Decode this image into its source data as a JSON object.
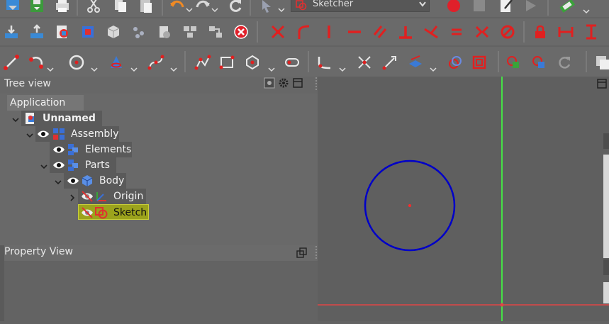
{
  "toolbar": {
    "workbench": {
      "label": "Sketcher",
      "icon": "sketcher-icon"
    },
    "row1_icons": [
      "import-icon",
      "save-icon",
      "print-icon",
      "cut-icon",
      "copy-icon",
      "paste-icon",
      "undo-icon",
      "redo-icon",
      "refresh-icon",
      "select-icon",
      "record-macro-icon",
      "stop-macro-icon",
      "macro-editor-icon",
      "run-macro-icon",
      "measure-icon"
    ],
    "row2_icons": [
      "assembly-import-icon",
      "assembly-export-icon",
      "insert-link-icon",
      "assembly-solve-icon",
      "part-icon",
      "assembly-parts-icon",
      "assembly-config-icon",
      "assembly-constraint-icon",
      "assembly-list-icon",
      "delete-constraint-icon",
      "fix-point-icon",
      "tangent-constraint-icon",
      "vertical-constraint-icon",
      "horizontal-constraint-icon",
      "parallel-constraint-icon",
      "perpendicular-constraint-icon",
      "angle-constraint-icon",
      "equal-constraint-icon",
      "symmetric-constraint-icon",
      "block-constraint-icon",
      "lock-constraint-icon",
      "horizontal-distance-icon",
      "vertical-distance-icon"
    ],
    "row3_icons": [
      "line-icon",
      "arc-icon",
      "circle-icon",
      "conic-icon",
      "bspline-icon",
      "polyline-icon",
      "rectangle-icon",
      "polygon-icon",
      "slot-icon",
      "fillet-icon",
      "trim-icon",
      "extend-icon",
      "external-geometry-icon",
      "carbon-copy-icon",
      "construction-mode-icon",
      "clone-icon",
      "copy-geometry-icon",
      "move-icon",
      "rectangular-array-icon",
      "restore-icon",
      "view-section-icon"
    ]
  },
  "tree_view": {
    "title": "Tree view",
    "header": "Application",
    "nodes": [
      {
        "label": "Unnamed *",
        "icon": "document-icon",
        "bold": true
      },
      {
        "label": "Assembly",
        "icon": "assembly-icon"
      },
      {
        "label": "Elements",
        "icon": "elements-icon"
      },
      {
        "label": "Parts",
        "icon": "parts-icon"
      },
      {
        "label": "Body",
        "icon": "body-icon"
      },
      {
        "label": "Origin",
        "icon": "origin-icon"
      },
      {
        "label": "Sketch",
        "icon": "sketch-icon",
        "selected": true
      }
    ]
  },
  "property_view": {
    "title": "Property View"
  },
  "colors": {
    "circle": "#0000c8",
    "axis_vertical": "#46e046",
    "axis_horizontal": "#e04646",
    "center_point": "#ff2a2a",
    "selected_bg": "#9ca31c"
  }
}
